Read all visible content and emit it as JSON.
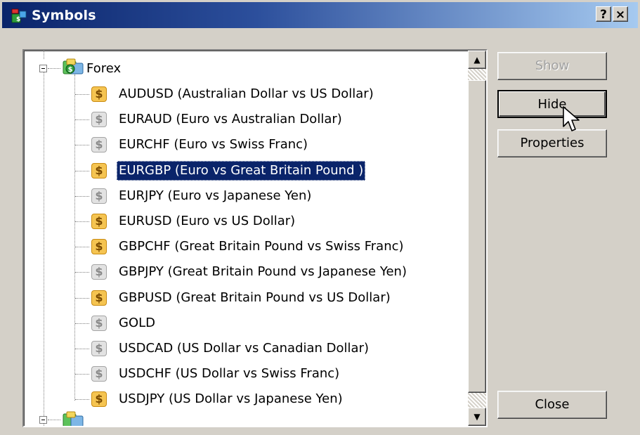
{
  "window": {
    "title": "Symbols",
    "help_label": "?",
    "close_label": "×"
  },
  "tree": {
    "group": {
      "label": "Forex",
      "expanded": true
    },
    "items": [
      {
        "label": "AUDUSD  (Australian Dollar vs US Dollar)",
        "enabled": true
      },
      {
        "label": "EURAUD  (Euro vs Australian Dollar)",
        "enabled": false
      },
      {
        "label": "EURCHF  (Euro vs Swiss Franc)",
        "enabled": false
      },
      {
        "label": "EURGBP  (Euro vs Great Britain Pound )",
        "enabled": true,
        "selected": true
      },
      {
        "label": "EURJPY  (Euro vs Japanese Yen)",
        "enabled": false
      },
      {
        "label": "EURUSD  (Euro vs US Dollar)",
        "enabled": true
      },
      {
        "label": "GBPCHF  (Great Britain Pound vs Swiss Franc)",
        "enabled": true
      },
      {
        "label": "GBPJPY  (Great Britain Pound vs Japanese Yen)",
        "enabled": false
      },
      {
        "label": "GBPUSD  (Great Britain Pound vs US Dollar)",
        "enabled": true
      },
      {
        "label": "GOLD",
        "enabled": false
      },
      {
        "label": "USDCAD  (US Dollar vs Canadian Dollar)",
        "enabled": false
      },
      {
        "label": "USDCHF  (US Dollar vs Swiss Franc)",
        "enabled": false
      },
      {
        "label": "USDJPY  (US Dollar vs Japanese Yen)",
        "enabled": true
      }
    ],
    "item_icon": "dollar-icon",
    "colors": {
      "selection": "#0a246a",
      "enabled_icon": "#f5c451",
      "disabled_icon": "#e2e2e2"
    }
  },
  "buttons": {
    "show": {
      "label": "Show",
      "enabled": false
    },
    "hide": {
      "label": "Hide",
      "enabled": true
    },
    "properties": {
      "label": "Properties",
      "enabled": true
    },
    "close": {
      "label": "Close",
      "enabled": true
    }
  },
  "scrollbar": {
    "up_arrow": "▲",
    "down_arrow": "▼"
  }
}
